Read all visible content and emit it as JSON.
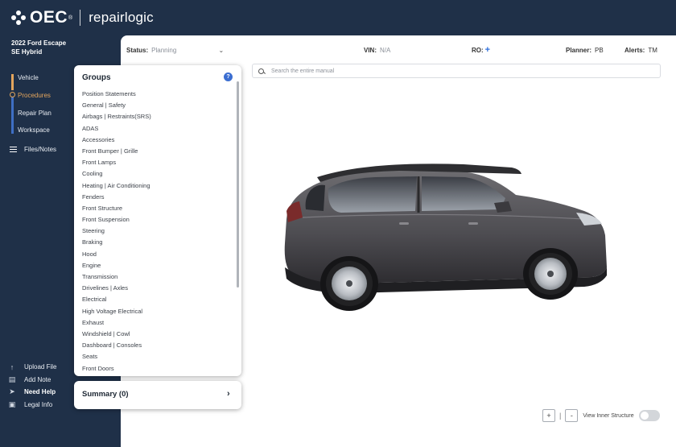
{
  "header": {
    "brand": "OEC",
    "trademark": "®",
    "product": "repairlogic"
  },
  "vehicle": {
    "title": "2022 Ford Escape SE Hybrid"
  },
  "nav": {
    "items": [
      {
        "label": "Vehicle",
        "active": false
      },
      {
        "label": "Procedures",
        "active": true
      },
      {
        "label": "Repair Plan",
        "active": false
      },
      {
        "label": "Workspace",
        "active": false
      }
    ],
    "files_notes": "Files/Notes"
  },
  "bottom_links": [
    {
      "label": "Upload File",
      "icon": "upload-icon"
    },
    {
      "label": "Add Note",
      "icon": "note-icon"
    },
    {
      "label": "Need Help",
      "icon": "send-icon"
    },
    {
      "label": "Legal Info",
      "icon": "briefcase-icon"
    }
  ],
  "statusbar": {
    "status_label": "Status:",
    "status_value": "Planning",
    "vin_label": "VIN:",
    "vin_value": "N/A",
    "ro_label": "RO:",
    "planner_label": "Planner:",
    "planner_value": "PB",
    "alerts_label": "Alerts:",
    "alerts_value": "TM"
  },
  "search": {
    "placeholder": "Search the entire manual"
  },
  "groups": {
    "title": "Groups",
    "items": [
      "Position Statements",
      "General | Safety",
      "Airbags | Restraints(SRS)",
      "ADAS",
      "Accessories",
      "Front Bumper | Grille",
      "Front Lamps",
      "Cooling",
      "Heating | Air Conditioning",
      "Fenders",
      "Front Structure",
      "Front Suspension",
      "Steering",
      "Braking",
      "Hood",
      "Engine",
      "Transmission",
      "Drivelines | Axles",
      "Electrical",
      "High Voltage Electrical",
      "Exhaust",
      "Windshield | Cowl",
      "Dashboard | Consoles",
      "Seats",
      "Front Doors"
    ]
  },
  "summary": {
    "label": "Summary (0)"
  },
  "viewer": {
    "zoom_in": "+",
    "separator": "|",
    "zoom_out": "-",
    "inner_structure_label": "View Inner Structure"
  },
  "colors": {
    "navy": "#1f3048",
    "accent": "#e3a55d",
    "link_blue": "#2f6fdc"
  }
}
